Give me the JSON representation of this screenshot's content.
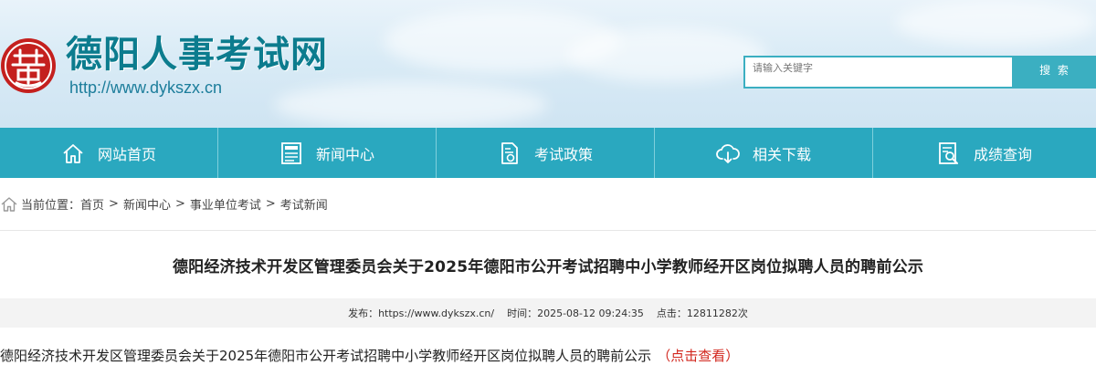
{
  "header": {
    "site_title": "德阳人事考试网",
    "site_url": "http://www.dykszx.cn",
    "logo_icon": "seal-logo-icon",
    "search": {
      "placeholder": "请输入关键字",
      "button_label": "搜 索"
    }
  },
  "nav": {
    "items": [
      {
        "label": "网站首页",
        "icon": "home-icon"
      },
      {
        "label": "新闻中心",
        "icon": "news-icon"
      },
      {
        "label": "考试政策",
        "icon": "policy-document-icon"
      },
      {
        "label": "相关下载",
        "icon": "cloud-download-icon"
      },
      {
        "label": "成绩查询",
        "icon": "search-document-icon"
      }
    ]
  },
  "breadcrumb": {
    "prefix": "当前位置：",
    "items": [
      "首页",
      "新闻中心",
      "事业单位考试",
      "考试新闻"
    ],
    "separator": ">"
  },
  "article": {
    "title": "德阳经济技术开发区管理委员会关于2025年德阳市公开考试招聘中小学教师经开区岗位拟聘人员的聘前公示",
    "meta": {
      "publisher_label": "发布：",
      "publisher": "https://www.dykszx.cn/",
      "time_label": "时间：",
      "time": "2025-08-12 09:24:35",
      "clicks_label": "点击：",
      "clicks": "12811282次"
    },
    "body_text": "德阳经济技术开发区管理委员会关于2025年德阳市公开考试招聘中小学教师经开区岗位拟聘人员的聘前公示",
    "body_link": "（点击查看）"
  },
  "colors": {
    "brand_teal": "#2aa8bf",
    "title_teal": "#0c7c8e",
    "link_red": "#d2261d",
    "logo_red": "#c4201e"
  }
}
